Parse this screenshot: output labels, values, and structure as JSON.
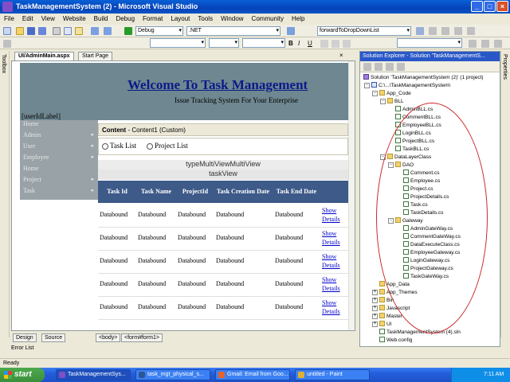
{
  "window": {
    "title": "TaskManagementSystem (2) - Microsoft Visual Studio",
    "buttons": {
      "minimize": "_",
      "maximize": "□",
      "close": "×"
    }
  },
  "menu": [
    "File",
    "Edit",
    "View",
    "Website",
    "Build",
    "Debug",
    "Format",
    "Layout",
    "Tools",
    "Window",
    "Community",
    "Help"
  ],
  "toolbar": {
    "config": "Debug",
    "platform": ".NET",
    "find": "forwardToDropDownList"
  },
  "side_strips": {
    "toolbox": "Toolbox",
    "properties": "Properties"
  },
  "doc_tabs": [
    {
      "label": "UI/AdminMain.aspx"
    },
    {
      "label": "Start Page"
    }
  ],
  "designer": {
    "welcome": "Welcome To Task Management",
    "tagline": "Issue Tracking System For Your Enterprise",
    "user_label": "[userIdLabel]",
    "left_menu": [
      {
        "label": "Home",
        "arrow": ""
      },
      {
        "label": "Admin",
        "arrow": "▸"
      },
      {
        "label": "User",
        "arrow": "▸"
      },
      {
        "label": "Employee",
        "arrow": "▸"
      },
      {
        "label": "Home",
        "arrow": ""
      },
      {
        "label": "Project",
        "arrow": "▸"
      },
      {
        "label": "Task",
        "arrow": "▸"
      }
    ],
    "content_header": {
      "name": "Content",
      "rest": " - Content1 (Custom)"
    },
    "radios": [
      "Task List",
      "Project List"
    ],
    "multiview": "typeMultiViewMultiView",
    "view": "taskView",
    "grid_headers": [
      "Task Id",
      "Task Name",
      "ProjectId",
      "Task Creation Date",
      "Task End Date"
    ],
    "grid_cell": "Databound",
    "grid_link": "Show Details",
    "grid_rows": 5
  },
  "design_bar": {
    "design": "Design",
    "source": "Source",
    "tags": [
      "<body>",
      "<form#form1>"
    ]
  },
  "error_list": "Error List",
  "solution_explorer": {
    "title": "Solution Explorer - Solution 'TaskManagementS...",
    "tree": [
      {
        "label": "Solution 'TaskManagementSystem (2)' (1 project)",
        "icon": "sol",
        "level": 0,
        "expander": ""
      },
      {
        "label": "C:\\...\\TaskManagementSystem\\",
        "icon": "proj",
        "level": 1,
        "expander": "-"
      },
      {
        "label": "App_Code",
        "icon": "folder",
        "level": 2,
        "expander": "-"
      },
      {
        "label": "BLL",
        "icon": "folder",
        "level": 3,
        "expander": "-"
      },
      {
        "label": "AdminBLL.cs",
        "icon": "file",
        "level": 4,
        "expander": ""
      },
      {
        "label": "CommentBLL.cs",
        "icon": "file",
        "level": 4,
        "expander": ""
      },
      {
        "label": "EmployeeBLL.cs",
        "icon": "file",
        "level": 4,
        "expander": ""
      },
      {
        "label": "LoginBLL.cs",
        "icon": "file",
        "level": 4,
        "expander": ""
      },
      {
        "label": "ProjectBLL.cs",
        "icon": "file",
        "level": 4,
        "expander": ""
      },
      {
        "label": "TaskBLL.cs",
        "icon": "file",
        "level": 4,
        "expander": ""
      },
      {
        "label": "DataLayerClass",
        "icon": "folder",
        "level": 3,
        "expander": "-"
      },
      {
        "label": "DAO",
        "icon": "folder",
        "level": 4,
        "expander": "-"
      },
      {
        "label": "Comment.cs",
        "icon": "file",
        "level": 5,
        "expander": ""
      },
      {
        "label": "Employee.cs",
        "icon": "file",
        "level": 5,
        "expander": ""
      },
      {
        "label": "Project.cs",
        "icon": "file",
        "level": 5,
        "expander": ""
      },
      {
        "label": "ProjectDetails.cs",
        "icon": "file",
        "level": 5,
        "expander": ""
      },
      {
        "label": "Task.cs",
        "icon": "file",
        "level": 5,
        "expander": ""
      },
      {
        "label": "TaskDetails.cs",
        "icon": "file",
        "level": 5,
        "expander": ""
      },
      {
        "label": "Gateway",
        "icon": "folder",
        "level": 4,
        "expander": "-"
      },
      {
        "label": "AdminGateWay.cs",
        "icon": "file",
        "level": 5,
        "expander": ""
      },
      {
        "label": "CommentGateWay.cs",
        "icon": "file",
        "level": 5,
        "expander": ""
      },
      {
        "label": "DataExecuteClass.cs",
        "icon": "file",
        "level": 5,
        "expander": ""
      },
      {
        "label": "EmployeeGateway.cs",
        "icon": "file",
        "level": 5,
        "expander": ""
      },
      {
        "label": "LoginGateway.cs",
        "icon": "file",
        "level": 5,
        "expander": ""
      },
      {
        "label": "ProjectGateway.cs",
        "icon": "file",
        "level": 5,
        "expander": ""
      },
      {
        "label": "TaskGateWay.cs",
        "icon": "file",
        "level": 5,
        "expander": ""
      },
      {
        "label": "App_Data",
        "icon": "folder",
        "level": 2,
        "expander": ""
      },
      {
        "label": "App_Themes",
        "icon": "folder",
        "level": 2,
        "expander": "+"
      },
      {
        "label": "Bin",
        "icon": "folder",
        "level": 2,
        "expander": "+"
      },
      {
        "label": "Javascript",
        "icon": "folder",
        "level": 2,
        "expander": "+"
      },
      {
        "label": "Master",
        "icon": "folder",
        "level": 2,
        "expander": "+"
      },
      {
        "label": "UI",
        "icon": "folder",
        "level": 2,
        "expander": "+"
      },
      {
        "label": "TaskManagementSystem (4).sln",
        "icon": "file",
        "level": 2,
        "expander": ""
      },
      {
        "label": "Web.config",
        "icon": "file",
        "level": 2,
        "expander": ""
      }
    ]
  },
  "status": "Ready",
  "taskbar": {
    "start": "start",
    "tasks": [
      {
        "label": "TaskManagementSys...",
        "color": "#7e4fc6"
      },
      {
        "label": "task_mgt_physical_s...",
        "color": "#2b5797"
      },
      {
        "label": "Gmail: Email from Goo...",
        "color": "#e8632a"
      },
      {
        "label": "untitled - Paint",
        "color": "#e0b030"
      }
    ],
    "clock": "7:11 AM"
  },
  "colors": {
    "title_blue": "#0543b8",
    "grid_header": "#3d5a88",
    "banner": "#6e8790",
    "annotation_oval": "#cc2a2a"
  }
}
